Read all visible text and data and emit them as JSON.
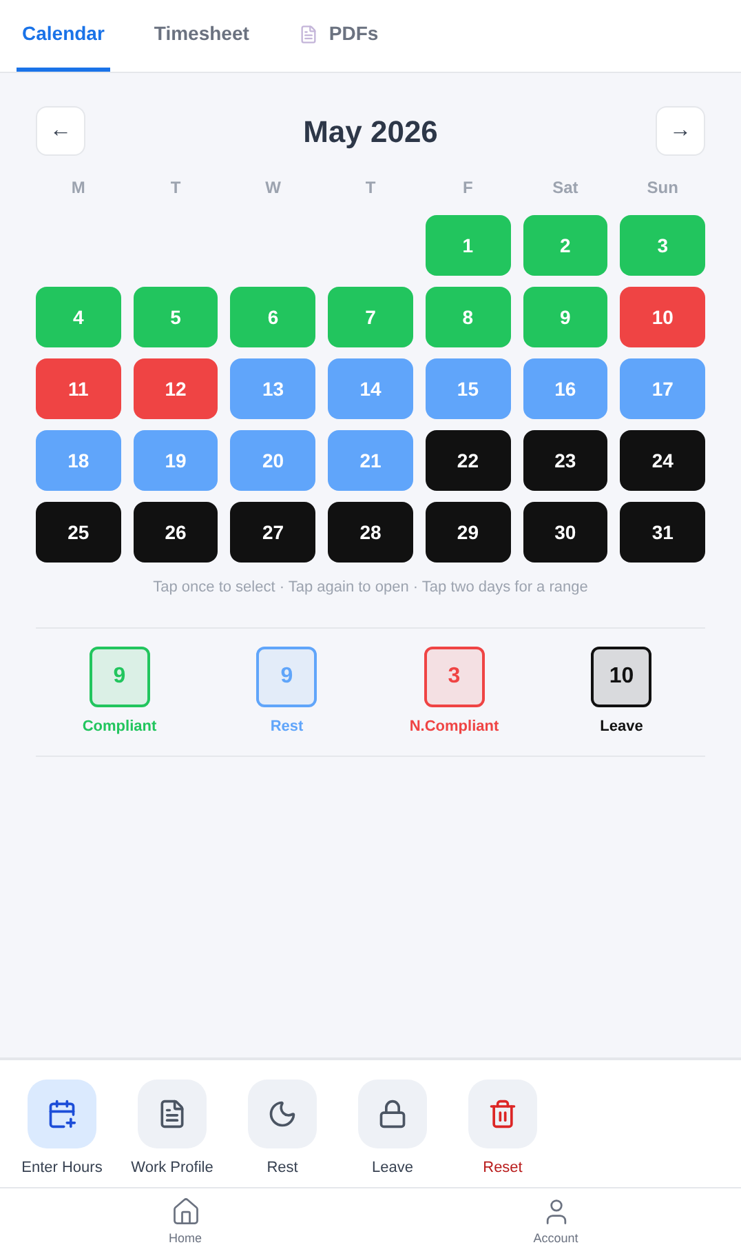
{
  "tabs": [
    {
      "label": "Calendar",
      "selected": true,
      "kind": "text"
    },
    {
      "label": "Timesheet",
      "selected": false,
      "kind": "text"
    },
    {
      "label": "PDFs",
      "selected": false,
      "kind": "document"
    }
  ],
  "month": {
    "prev": "←",
    "title": "May 2026",
    "next": "→"
  },
  "weekdays": [
    "M",
    "T",
    "W",
    "T",
    "F",
    "Sat",
    "Sun"
  ],
  "weeks": [
    [
      {
        "day": "1",
        "color": "#22c55e"
      },
      {
        "day": "2",
        "color": "#22c55e"
      },
      {
        "day": "3",
        "color": "#22c55e"
      }
    ],
    [
      {
        "day": "4",
        "color": "#22c55e"
      },
      {
        "day": "5",
        "color": "#22c55e"
      },
      {
        "day": "6",
        "color": "#22c55e"
      },
      {
        "day": "7",
        "color": "#22c55e"
      },
      {
        "day": "8",
        "color": "#22c55e"
      },
      {
        "day": "9",
        "color": "#22c55e"
      },
      {
        "day": "10",
        "color": "#ef4444"
      }
    ],
    [
      {
        "day": "11",
        "color": "#ef4444"
      },
      {
        "day": "12",
        "color": "#ef4444"
      },
      {
        "day": "13",
        "color": "#60a5fa"
      },
      {
        "day": "14",
        "color": "#60a5fa"
      },
      {
        "day": "15",
        "color": "#60a5fa"
      },
      {
        "day": "16",
        "color": "#60a5fa"
      },
      {
        "day": "17",
        "color": "#60a5fa"
      }
    ],
    [
      {
        "day": "18",
        "color": "#60a5fa"
      },
      {
        "day": "19",
        "color": "#60a5fa"
      },
      {
        "day": "20",
        "color": "#60a5fa"
      },
      {
        "day": "21",
        "color": "#60a5fa"
      },
      {
        "day": "22",
        "color": "#111111"
      },
      {
        "day": "23",
        "color": "#111111"
      },
      {
        "day": "24",
        "color": "#111111"
      }
    ],
    [
      {
        "day": "25",
        "color": "#111111"
      },
      {
        "day": "26",
        "color": "#111111"
      },
      {
        "day": "27",
        "color": "#111111"
      },
      {
        "day": "28",
        "color": "#111111"
      },
      {
        "day": "29",
        "color": "#111111"
      },
      {
        "day": "30",
        "color": "#111111"
      },
      {
        "day": "31",
        "color": "#111111"
      }
    ]
  ],
  "hint": "Tap once to select · Tap again to open · Tap two days for a range",
  "summary": [
    {
      "count": "9",
      "label": "Compliant",
      "color": "#22c55e"
    },
    {
      "count": "9",
      "label": "Rest",
      "color": "#60a5fa"
    },
    {
      "count": "3",
      "label": "N.Compliant",
      "color": "#ef4444"
    },
    {
      "count": "10",
      "label": "Leave",
      "color": "#111111"
    }
  ],
  "actions": [
    {
      "label": "Enter Hours",
      "kind": "enter"
    },
    {
      "label": "Work Profile",
      "kind": "profile"
    },
    {
      "label": "Rest",
      "kind": "rest"
    },
    {
      "label": "Leave",
      "kind": "leave"
    },
    {
      "label": "Reset",
      "kind": "reset"
    }
  ],
  "nav": [
    {
      "label": "Home",
      "kind": "home"
    },
    {
      "label": "Account",
      "kind": "account"
    }
  ]
}
